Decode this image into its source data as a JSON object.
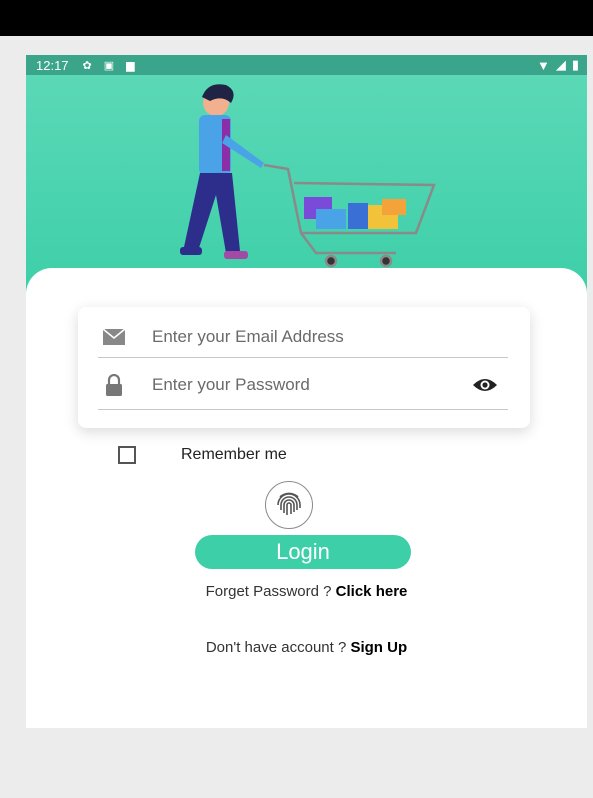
{
  "status_bar": {
    "time": "12:17"
  },
  "login_form": {
    "email_placeholder": "Enter your Email Address",
    "password_placeholder": "Enter your Password",
    "remember_label": "Remember me",
    "login_label": "Login",
    "forgot_text": "Forget Password ? ",
    "forgot_link": "Click here",
    "signup_text": "Don't have account ? ",
    "signup_link": "Sign Up"
  },
  "icons": {
    "email": "envelope-icon",
    "password": "lock-icon",
    "visibility": "eye-icon",
    "biometric": "fingerprint-icon",
    "status": [
      "settings-icon",
      "notification-icon",
      "sd-card-icon",
      "wifi-icon",
      "signal-icon",
      "battery-icon"
    ]
  },
  "colors": {
    "accent": "#3ccfa8",
    "hero_top": "#5ed9b8",
    "status_bar": "#3aa58a",
    "background": "#ececec"
  }
}
